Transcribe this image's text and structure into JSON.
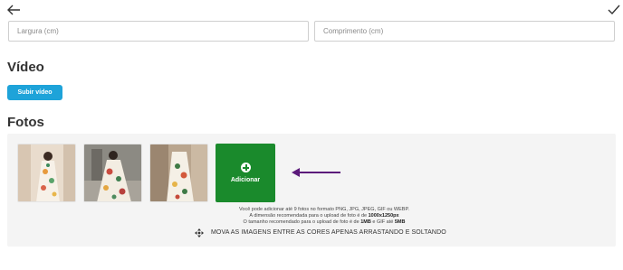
{
  "header": {
    "back_icon": "arrow-left-icon",
    "confirm_icon": "checkmark-icon"
  },
  "dimensions": {
    "width_placeholder": "Largura (cm)",
    "length_placeholder": "Comprimento (cm)"
  },
  "video": {
    "title": "Vídeo",
    "upload_label": "Subir vídeo",
    "upload_color": "#1ea3d9"
  },
  "photos": {
    "title": "Fotos",
    "thumbnails": [
      {
        "label": "photo-1"
      },
      {
        "label": "photo-2"
      },
      {
        "label": "photo-3"
      }
    ],
    "add_label": "Adicionar",
    "add_color": "#1a8a2c",
    "annotation_arrow_color": "#5b1a7a",
    "info": {
      "line1": "Você pode adicionar até 9 fotos no formato PNG, JPG, JPEG, GIF ou WEBP.",
      "line2_prefix": "A dimensão recomendada para o upload de foto é de ",
      "line2_value": "1000x1250px",
      "line3_prefix": "O tamanho recomendado para o upload de foto é de ",
      "line3_value1": "1MB",
      "line3_mid": " e GIF até ",
      "line3_value2": "5MB"
    },
    "move_hint": "MOVA AS IMAGENS ENTRE AS CORES APENAS ARRASTANDO E SOLTANDO"
  }
}
